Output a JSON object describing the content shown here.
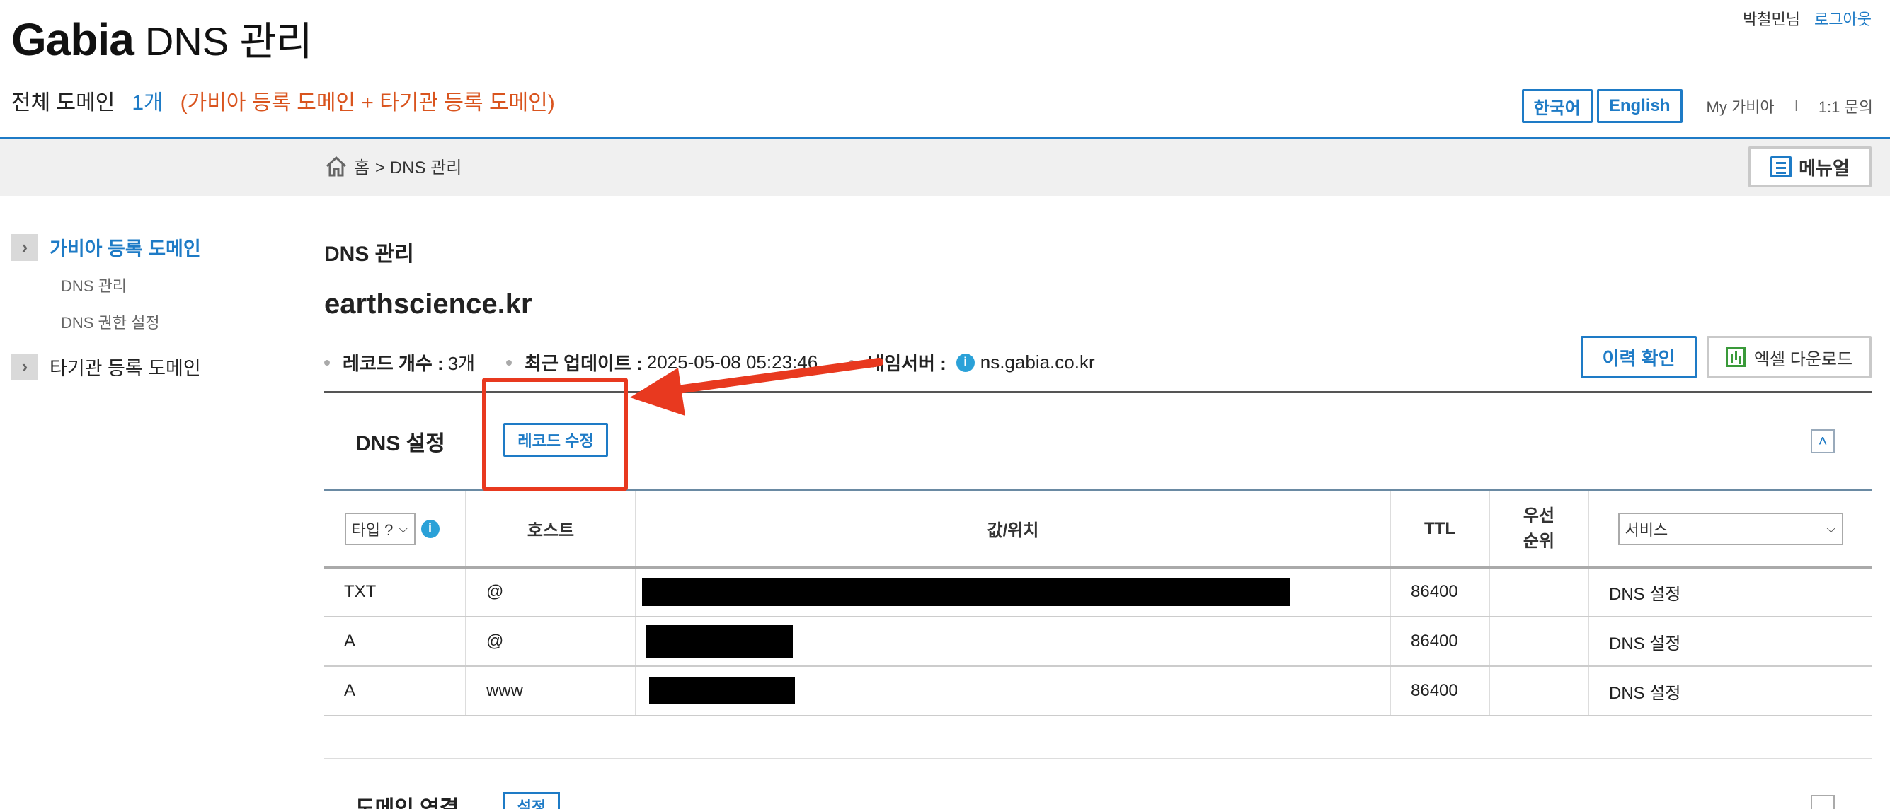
{
  "header": {
    "logo": "Gabia",
    "title": "DNS 관리",
    "summary_label": "전체 도메인",
    "summary_count": "1개",
    "summary_desc": "(가비아 등록 도메인 + 타기관 등록 도메인)",
    "user_name": "박철민님",
    "logout": "로그아웃",
    "lang_ko": "한국어",
    "lang_en": "English",
    "my_gabia": "My 가비아",
    "separator": "I",
    "inquiry": "1:1 문의"
  },
  "breadcrumb": {
    "home": "홈",
    "path": "> DNS 관리",
    "manual": "메뉴얼"
  },
  "sidebar": {
    "items": [
      {
        "label": "가비아 등록 도메인",
        "active": true,
        "children": [
          "DNS 관리",
          "DNS 권한 설정"
        ]
      },
      {
        "label": "타기관 등록 도메인",
        "active": false
      }
    ]
  },
  "main": {
    "title": "DNS 관리",
    "domain": "earthscience.kr",
    "record_count_label": "레코드 개수 :",
    "record_count": "3개",
    "updated_label": "최근 업데이트 :",
    "updated": "2025-05-08 05:23:46",
    "nameserver_label": "네임서버 :",
    "nameserver": "ns.gabia.co.kr",
    "history_btn": "이력 확인",
    "excel_btn": "엑셀 다운로드",
    "panel_title": "DNS 설정",
    "record_edit_btn": "레코드 수정",
    "bottom_title": "도메인 연결",
    "bottom_btn": "설정"
  },
  "table": {
    "type_filter": "타입 ?",
    "headers": [
      "호스트",
      "값/위치",
      "TTL",
      "우선 순위"
    ],
    "service_filter": "서비스",
    "rows": [
      {
        "type": "TXT",
        "host": "@",
        "ttl": "86400",
        "priority": "",
        "service": "DNS 설정"
      },
      {
        "type": "A",
        "host": "@",
        "ttl": "86400",
        "priority": "",
        "service": "DNS 설정"
      },
      {
        "type": "A",
        "host": "www",
        "ttl": "86400",
        "priority": "",
        "service": "DNS 설정"
      }
    ]
  },
  "colors": {
    "accent": "#1e7bc6",
    "highlight": "#d9541e",
    "annotation": "#e8391f"
  }
}
